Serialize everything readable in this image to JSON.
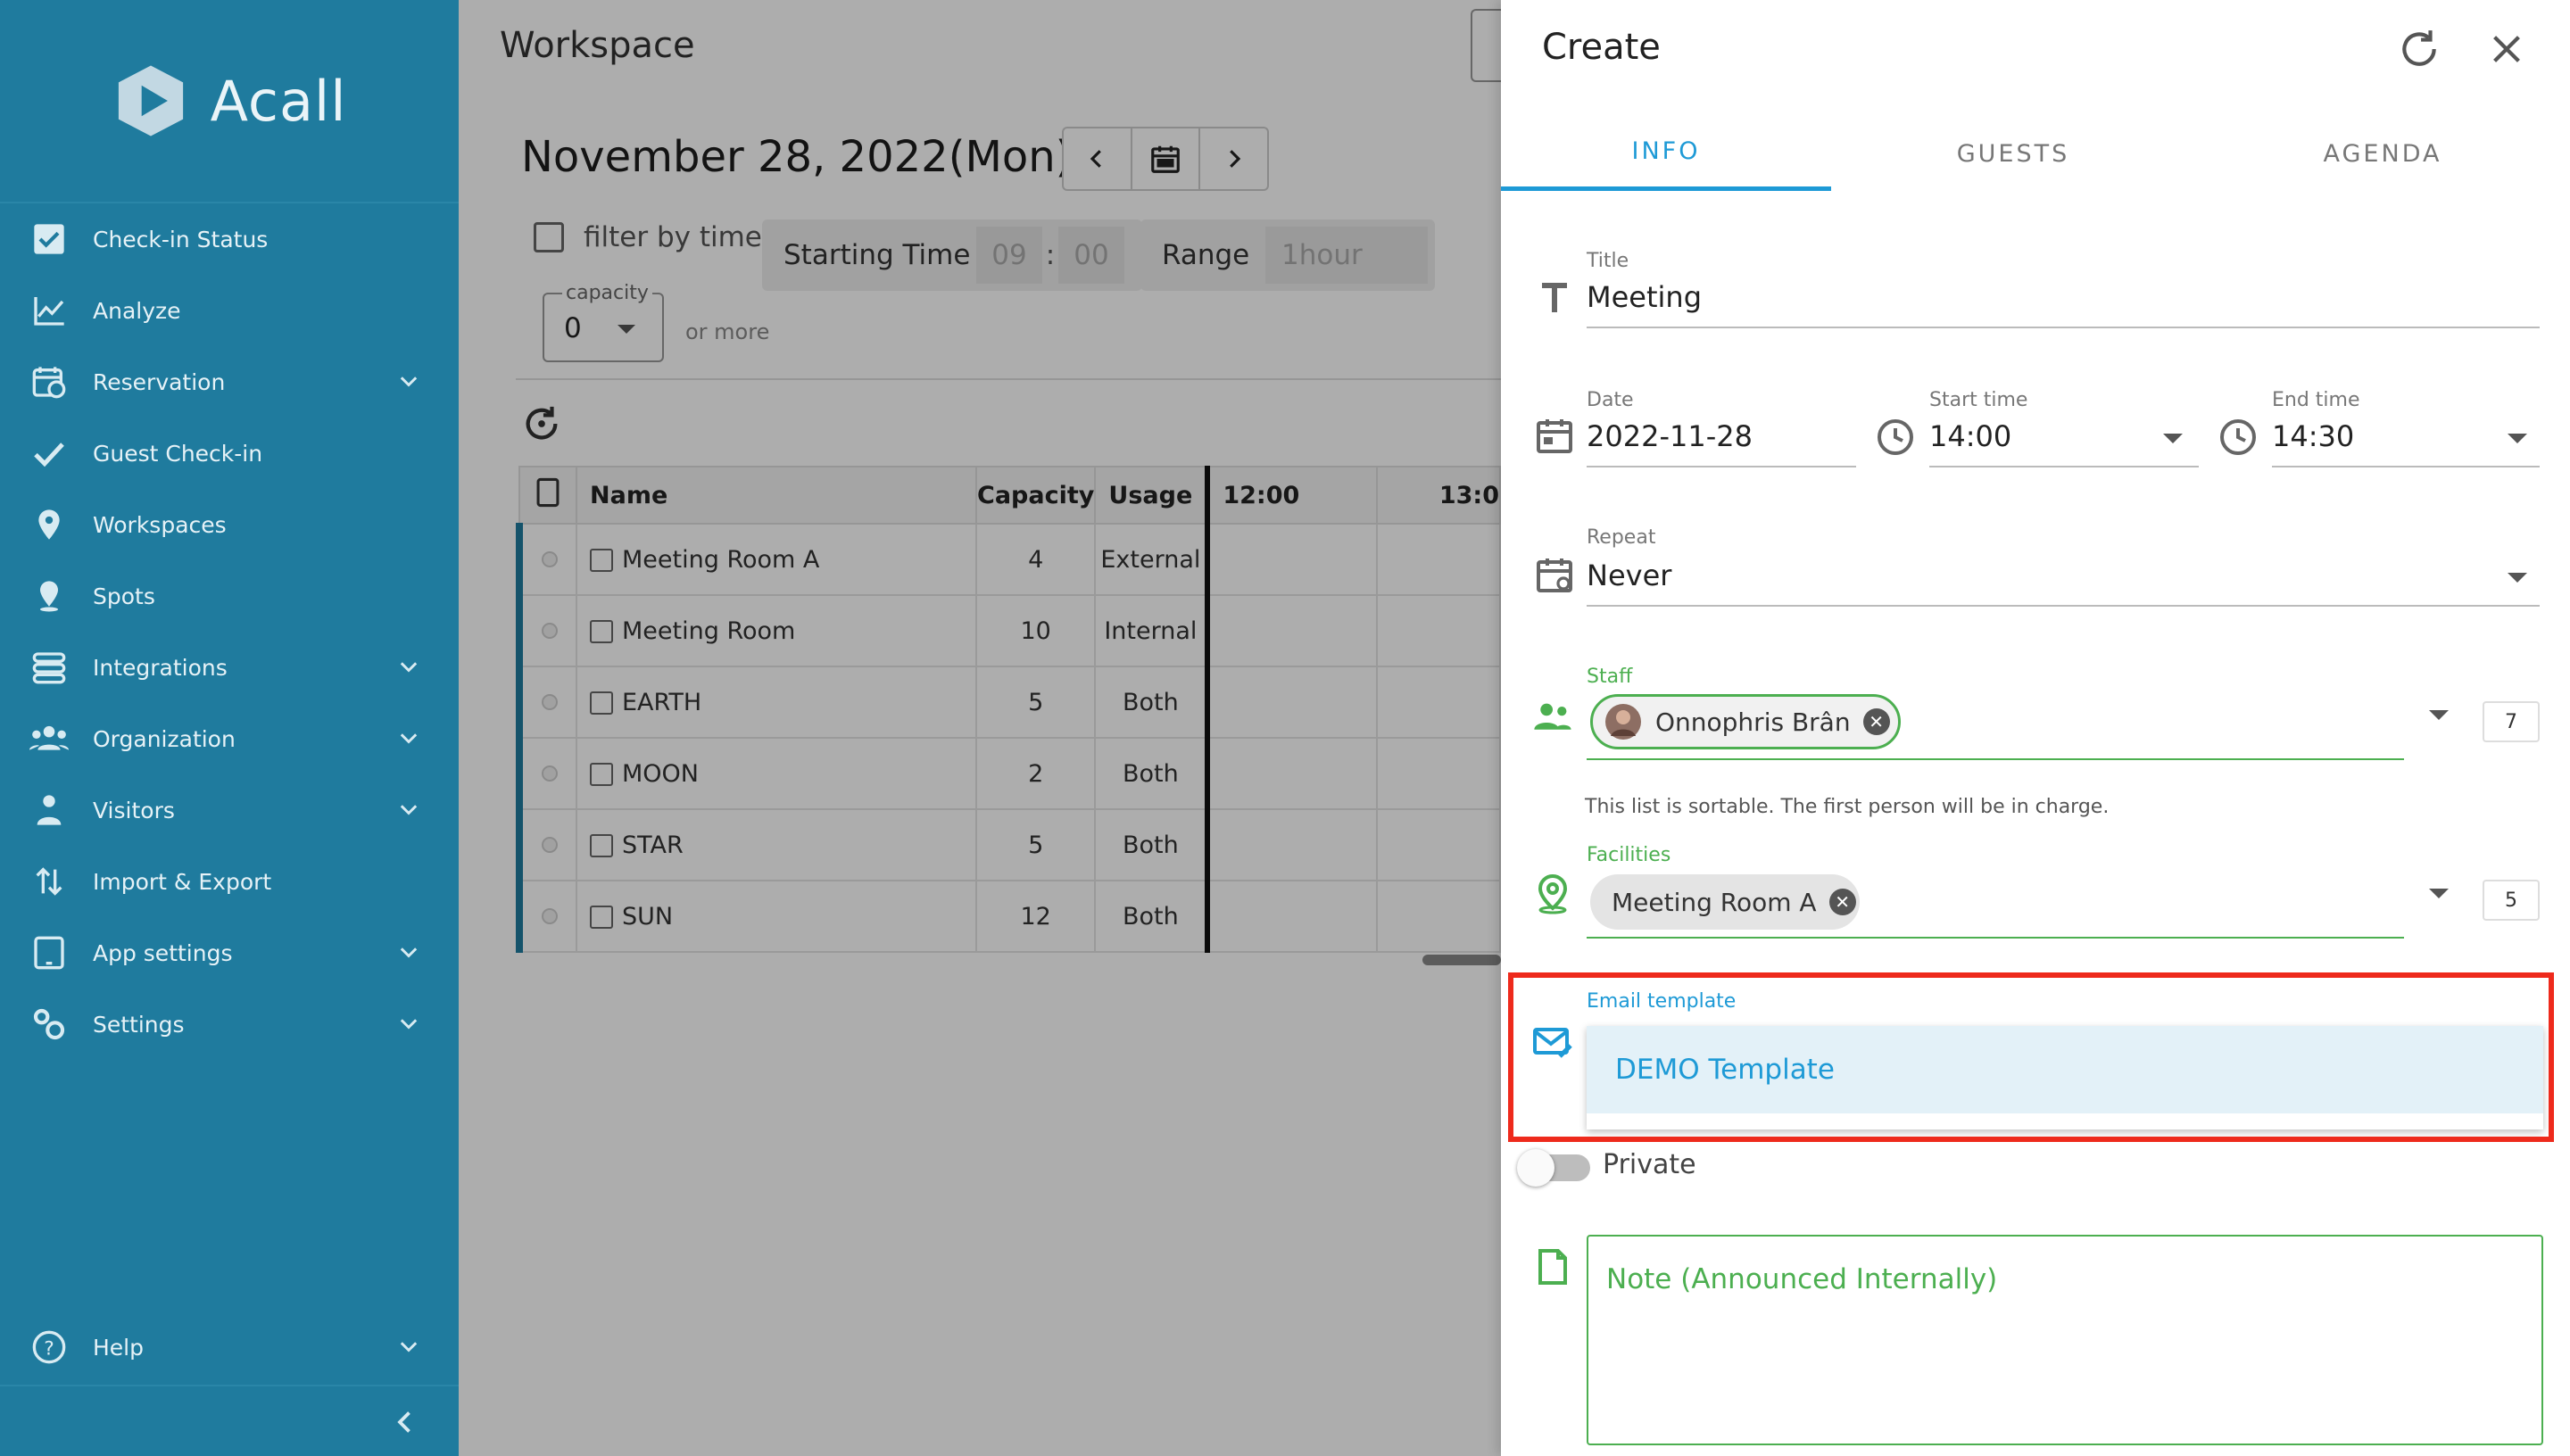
{
  "sidebar": {
    "logo_text": "Acall",
    "items": [
      {
        "label": "Check-in Status",
        "icon": "checkbox-icon",
        "has_chevron": false
      },
      {
        "label": "Analyze",
        "icon": "line-chart-icon",
        "has_chevron": false
      },
      {
        "label": "Reservation",
        "icon": "calendar-clock-icon",
        "has_chevron": true
      },
      {
        "label": "Guest Check-in",
        "icon": "checkmark-icon",
        "has_chevron": false
      },
      {
        "label": "Workspaces",
        "icon": "location-pin-icon",
        "has_chevron": false
      },
      {
        "label": "Spots",
        "icon": "person-pin-icon",
        "has_chevron": false
      },
      {
        "label": "Integrations",
        "icon": "integrations-icon",
        "has_chevron": true
      },
      {
        "label": "Organization",
        "icon": "people-icon",
        "has_chevron": true
      },
      {
        "label": "Visitors",
        "icon": "visitor-icon",
        "has_chevron": true
      },
      {
        "label": "Import & Export",
        "icon": "import-export-icon",
        "has_chevron": false
      },
      {
        "label": "App settings",
        "icon": "tablet-icon",
        "has_chevron": true
      },
      {
        "label": "Settings",
        "icon": "gears-icon",
        "has_chevron": true
      }
    ],
    "help_label": "Help"
  },
  "main": {
    "title": "Workspace",
    "date": "November 28, 2022(Mon)",
    "filter_label": "filter by time",
    "starting_time_label": "Starting Time",
    "start_hour": "09",
    "start_minute": "00",
    "range_label": "Range",
    "range_value": "1hour",
    "capacity_label": "capacity",
    "capacity_value": "0",
    "or_more": "or more",
    "table": {
      "headers": {
        "name": "Name",
        "capacity": "Capacity",
        "usage": "Usage",
        "t1": "12:00",
        "t2": "13:0"
      },
      "rows": [
        {
          "name": "Meeting Room A",
          "capacity": "4",
          "usage": "External"
        },
        {
          "name": "Meeting Room",
          "capacity": "10",
          "usage": "Internal"
        },
        {
          "name": "EARTH",
          "capacity": "5",
          "usage": "Both"
        },
        {
          "name": "MOON",
          "capacity": "2",
          "usage": "Both"
        },
        {
          "name": "STAR",
          "capacity": "5",
          "usage": "Both"
        },
        {
          "name": "SUN",
          "capacity": "12",
          "usage": "Both"
        }
      ]
    }
  },
  "panel": {
    "title": "Create",
    "tabs": [
      "INFO",
      "GUESTS",
      "AGENDA"
    ],
    "active_tab": "INFO",
    "title_field": {
      "label": "Title",
      "value": "Meeting"
    },
    "date_field": {
      "label": "Date",
      "value": "2022-11-28"
    },
    "start_field": {
      "label": "Start time",
      "value": "14:00"
    },
    "end_field": {
      "label": "End time",
      "value": "14:30"
    },
    "repeat_field": {
      "label": "Repeat",
      "value": "Never"
    },
    "staff_field": {
      "label": "Staff",
      "chip": "Onnophris Brân",
      "count": "7"
    },
    "sortable_hint": "This list is sortable. The first person will be in charge.",
    "facilities_field": {
      "label": "Facilities",
      "chip": "Meeting Room A",
      "count": "5"
    },
    "email_field": {
      "label": "Email template",
      "option": "DEMO Template"
    },
    "private_label": "Private",
    "note_placeholder": "Note (Announced Internally)"
  },
  "colors": {
    "sidebar": "#1f7b9e",
    "accent": "#1e9ad6",
    "green": "#4caf50",
    "highlight": "#ee2a1c"
  }
}
